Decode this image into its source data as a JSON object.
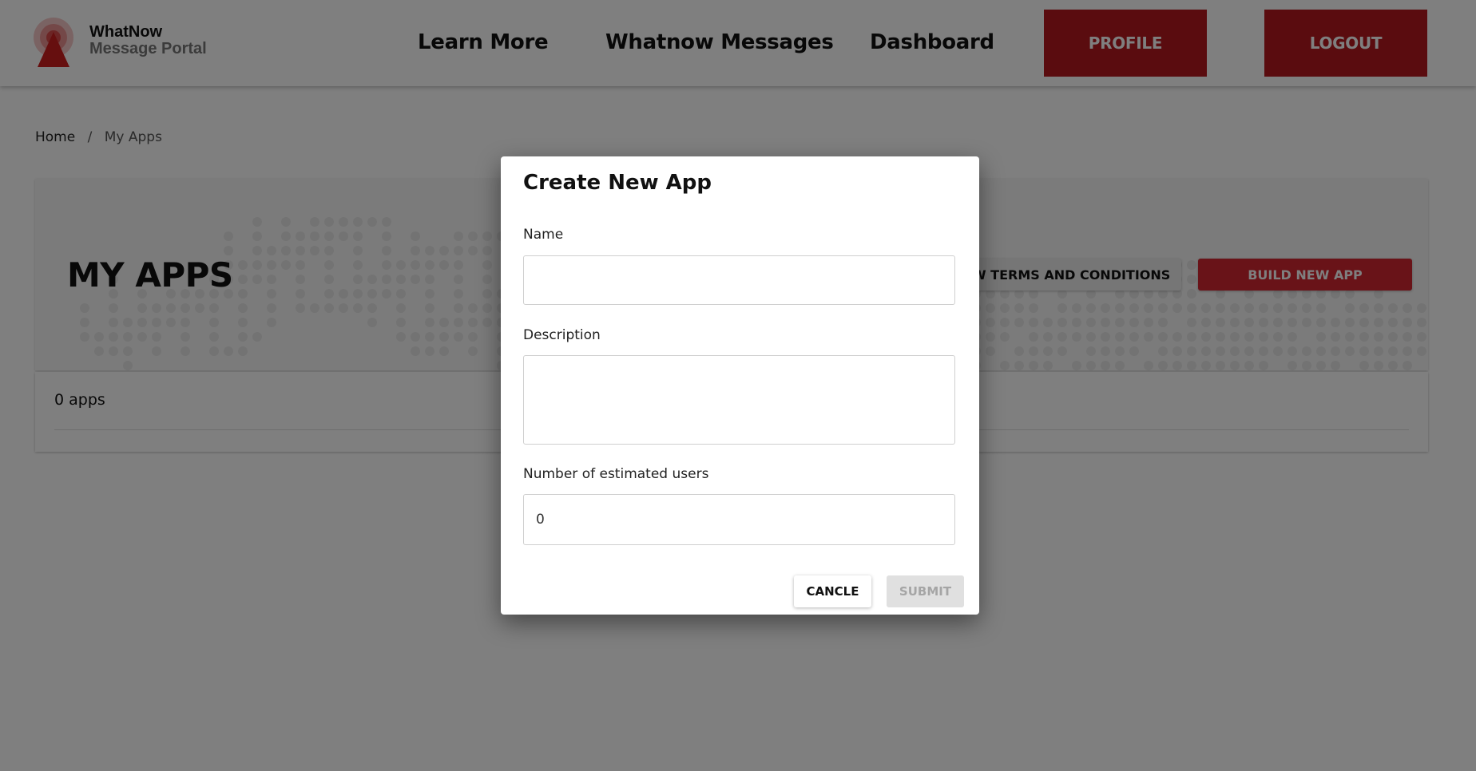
{
  "brand": {
    "line1": "WhatNow",
    "line2": "Message Portal"
  },
  "nav": {
    "learn_more": "Learn More",
    "messages": "Whatnow Messages",
    "dashboard": "Dashboard",
    "profile": "PROFILE",
    "logout": "LOGOUT"
  },
  "breadcrumb": {
    "home": "Home",
    "separator": "/",
    "current": "My Apps"
  },
  "hero": {
    "title": "MY APPS",
    "terms_button": "VIEW TERMS AND CONDITIONS",
    "build_button": "BUILD NEW APP"
  },
  "apps": {
    "count_label": "0 apps"
  },
  "modal": {
    "title": "Create New App",
    "name_label": "Name",
    "name_value": "",
    "description_label": "Description",
    "description_value": "",
    "users_label": "Number of estimated users",
    "users_value": "0",
    "cancel_button": "CANCLE",
    "submit_button": "SUBMIT"
  },
  "colors": {
    "brand_red": "#b5191f",
    "build_red": "#d32630",
    "overlay": "rgba(0,0,0,0.5)"
  }
}
